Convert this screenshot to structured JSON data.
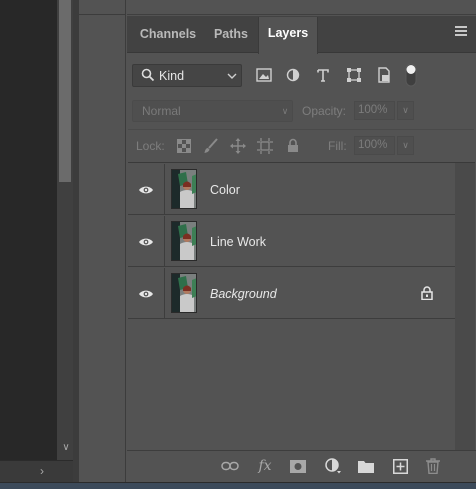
{
  "panel_tabs": [
    {
      "label": "Channels",
      "active": false
    },
    {
      "label": "Paths",
      "active": false
    },
    {
      "label": "Layers",
      "active": true
    }
  ],
  "filter": {
    "kind_label": "Kind"
  },
  "blend": {
    "mode": "Normal",
    "opacity_label": "Opacity:",
    "opacity_value": "100%",
    "lock_label": "Lock:",
    "fill_label": "Fill:",
    "fill_value": "100%"
  },
  "layers": [
    {
      "name": "Color",
      "visible": true,
      "locked": false,
      "italic": false
    },
    {
      "name": "Line Work",
      "visible": true,
      "locked": false,
      "italic": false
    },
    {
      "name": "Background",
      "visible": true,
      "locked": true,
      "italic": true
    }
  ],
  "footer_icons": [
    "link-layers-icon",
    "fx-icon",
    "add-mask-icon",
    "adjustment-layer-icon",
    "new-group-icon",
    "new-layer-icon",
    "delete-layer-icon"
  ],
  "colors": {
    "panel_bg": "#535353",
    "tabbar_bg": "#424242",
    "doc_bg": "#282828",
    "text_active": "#ffffff",
    "text_dim": "#7d7d7d"
  }
}
